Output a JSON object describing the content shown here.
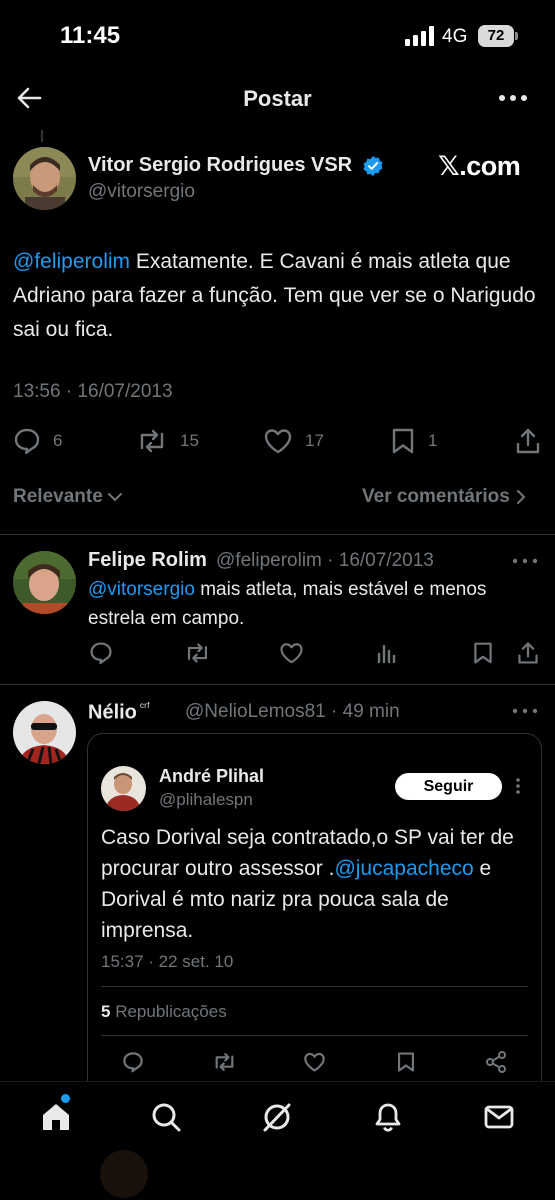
{
  "status_bar": {
    "time": "11:45",
    "network": "4G",
    "battery": "72"
  },
  "header": {
    "title": "Postar"
  },
  "main_post": {
    "author_name": "Vitor Sergio Rodrigues VSR",
    "handle": "@vitorsergio",
    "source_logo": "𝕏.com",
    "mention": "@feliperolim",
    "text": " Exatamente. E Cavani é mais atleta que Adriano para fazer a função. Tem que ver se o Narigudo sai ou fica.",
    "timestamp": "13:56 · 16/07/2013",
    "stats": {
      "replies": "6",
      "reposts": "15",
      "likes": "17",
      "bookmarks": "1"
    }
  },
  "sort": {
    "label": "Relevante",
    "view_comments": "Ver comentários"
  },
  "replies": [
    {
      "name": "Felipe Rolim",
      "meta": "@feliperolim · 16/07/2013",
      "mention": "@vitorsergio",
      "text": " mais atleta, mais estável e menos estrela em campo."
    },
    {
      "name": "Nélio",
      "superscript": "ᶜʳᶠ",
      "meta": "@NelioLemos81 · 49 min",
      "quote": {
        "name": "André Plihal",
        "handle": "@plihalespn",
        "follow_label": "Seguir",
        "text_before": "Caso Dorival seja contratado,o SP vai ter de procurar outro assessor .",
        "mention": "@jucapacheco",
        "text_after": " e Dorival é mto nariz pra pouca sala de imprensa.",
        "timestamp": "15:37 · 22 set. 10",
        "repost_count": "5",
        "repost_label": "Republicações"
      }
    }
  ],
  "colors": {
    "accent": "#1d9bf0",
    "muted": "#71767b",
    "text": "#e7e9ea",
    "background": "#000000",
    "divider": "#2f3336"
  },
  "tab_bar": {
    "icons": [
      "home-icon",
      "search-icon",
      "grok-icon",
      "notifications-icon",
      "messages-icon"
    ]
  }
}
